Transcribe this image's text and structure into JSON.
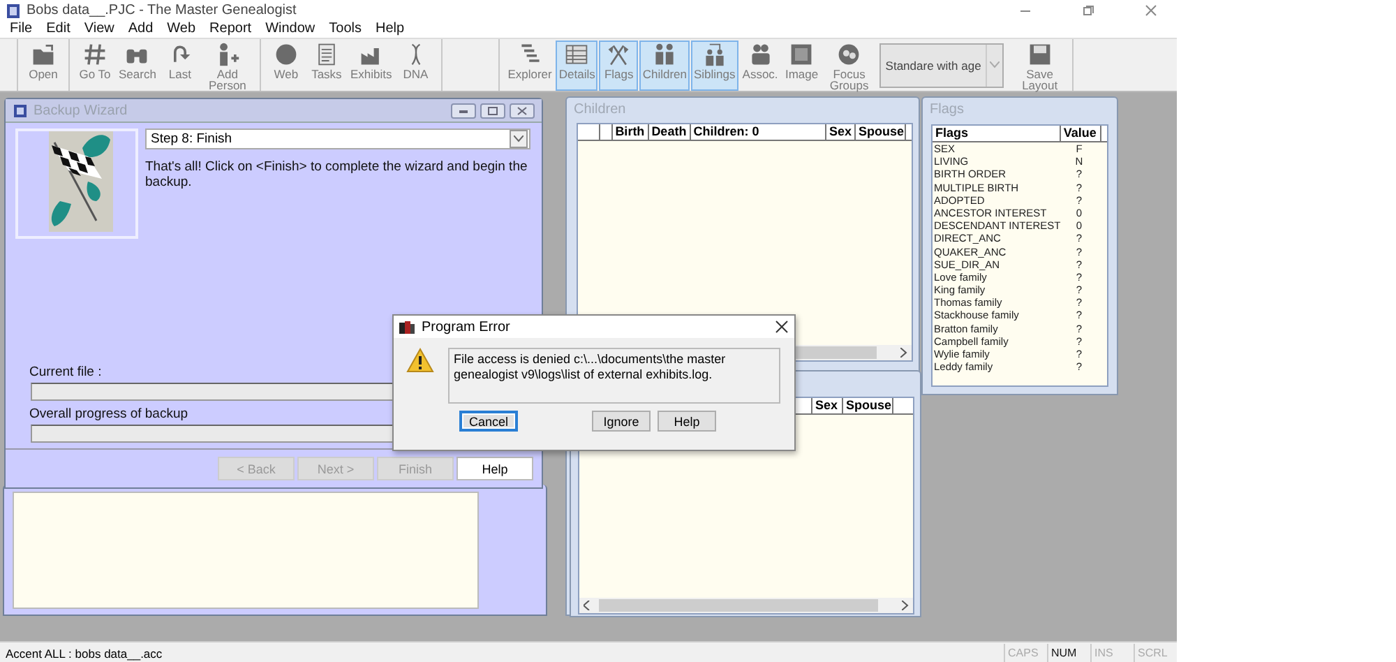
{
  "window": {
    "title": "Bobs data__.PJC - The Master Genealogist"
  },
  "menu": [
    "File",
    "Edit",
    "View",
    "Add",
    "Web",
    "Report",
    "Window",
    "Tools",
    "Help"
  ],
  "toolbar": {
    "groups": [
      {
        "items": [
          {
            "kind": "button",
            "label": "Open",
            "selected": false
          }
        ]
      },
      {
        "items": [
          {
            "kind": "button",
            "label": "Go To",
            "selected": false
          },
          {
            "kind": "button",
            "label": "Search",
            "selected": false
          },
          {
            "kind": "button",
            "label": "Last",
            "selected": false
          },
          {
            "kind": "button",
            "label": "Add Person",
            "selected": false
          }
        ]
      },
      {
        "items": [
          {
            "kind": "button",
            "label": "Web",
            "selected": false
          },
          {
            "kind": "button",
            "label": "Tasks",
            "selected": false
          },
          {
            "kind": "button",
            "label": "Exhibits",
            "selected": false
          },
          {
            "kind": "button",
            "label": "DNA",
            "selected": false
          }
        ]
      },
      {
        "items": [
          {
            "kind": "button",
            "label": "Explorer",
            "selected": false
          },
          {
            "kind": "button",
            "label": "Details",
            "selected": true
          },
          {
            "kind": "button",
            "label": "Flags",
            "selected": true
          },
          {
            "kind": "button",
            "label": "Children",
            "selected": true
          },
          {
            "kind": "button",
            "label": "Siblings",
            "selected": true
          },
          {
            "kind": "button",
            "label": "Assoc.",
            "selected": false
          },
          {
            "kind": "button",
            "label": "Image",
            "selected": false
          },
          {
            "kind": "button",
            "label": "Focus Groups",
            "selected": false
          },
          {
            "kind": "combo",
            "value": "Standare with age"
          },
          {
            "kind": "button",
            "label": "Save Layout",
            "selected": false
          }
        ]
      }
    ]
  },
  "wizard": {
    "title": "Backup Wizard",
    "step": "Step 8: Finish",
    "message": "That's all!  Click on <Finish> to complete the wizard and begin the backup.",
    "current_file_label": "Current file :",
    "overall_label": "Overall progress of backup",
    "progress": {
      "level": 0
    },
    "buttons": [
      {
        "label": "< Back",
        "disabled": true
      },
      {
        "label": "Next >",
        "disabled": true
      },
      {
        "label": "Finish",
        "disabled": true
      },
      {
        "label": "Help",
        "disabled": false
      }
    ]
  },
  "children": {
    "title": "Children",
    "columns": [
      "",
      "",
      "Birth",
      "Death",
      "Children: 0",
      "Sex",
      "Spouse"
    ],
    "lower_columns": [
      "Sex",
      "Spouse"
    ]
  },
  "flags": {
    "title": "Flags",
    "columns": [
      "Flags",
      "Value"
    ],
    "rows": [
      [
        "SEX",
        "F"
      ],
      [
        "LIVING",
        "N"
      ],
      [
        "BIRTH ORDER",
        "?"
      ],
      [
        "MULTIPLE BIRTH",
        "?"
      ],
      [
        "ADOPTED",
        "?"
      ],
      [
        "ANCESTOR INTEREST",
        "0"
      ],
      [
        "DESCENDANT INTEREST",
        "0"
      ],
      [
        "DIRECT_ANC",
        "?"
      ],
      [
        "QUAKER_ANC",
        "?"
      ],
      [
        "SUE_DIR_AN",
        "?"
      ],
      [
        "Love family",
        "?"
      ],
      [
        "King family",
        "?"
      ],
      [
        "Thomas family",
        "?"
      ],
      [
        "Stackhouse family",
        "?"
      ],
      [
        "Bratton family",
        "?"
      ],
      [
        "Campbell family",
        "?"
      ],
      [
        "Wylie family",
        "?"
      ],
      [
        "Leddy family",
        "?"
      ]
    ]
  },
  "dialog": {
    "title": "Program Error",
    "message": "File access is denied c:\\...\\documents\\the master genealogist v9\\logs\\list of external exhibits.log.",
    "buttons": [
      {
        "label": "Cancel",
        "focused": true
      },
      {
        "label": "Ignore",
        "focused": false
      },
      {
        "label": "Help",
        "focused": false
      }
    ]
  },
  "status_bar": {
    "text": "Accent ALL : bobs data__.acc",
    "indicators": [
      {
        "label": "CAPS",
        "on": false
      },
      {
        "label": "NUM",
        "on": true
      },
      {
        "label": "INS",
        "on": false
      },
      {
        "label": "SCRL",
        "on": false
      }
    ]
  }
}
